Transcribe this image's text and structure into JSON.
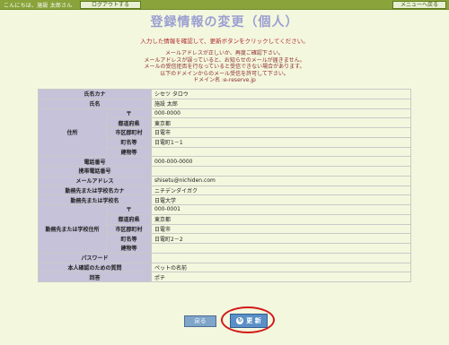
{
  "header": {
    "greeting": "こんにちは、施設 太郎さん",
    "logout_label": "ログアウトする",
    "menu_label": "メニューへ戻る"
  },
  "page": {
    "title": "登録情報の変更（個人）",
    "instruction": "入力した情報を確認して、更新ボタンをクリックしてください。",
    "notes": [
      "メールアドレスが正しいか、再度ご確認下さい。",
      "メールアドレスが誤っていると、お知らせのメールが届きません。",
      "メールの受信拒否を行なっていると受信できない場合があります。",
      "以下のドメインからのメール受信を許可して下さい。",
      "ドメイン名 :e-reserve.jp"
    ]
  },
  "form": {
    "kana_name": {
      "label": "氏名カナ",
      "value": "シセツ タロウ"
    },
    "name": {
      "label": "氏名",
      "value": "施設 太郎"
    },
    "address": {
      "label": "住所",
      "postal": {
        "label": "〒",
        "value": "000-0000"
      },
      "prefecture": {
        "label": "都道府県",
        "value": "東京都"
      },
      "city": {
        "label": "市区郡町村",
        "value": "日電市"
      },
      "town": {
        "label": "町名等",
        "value": "日電町1－1"
      },
      "building": {
        "label": "建物等",
        "value": ""
      }
    },
    "phone": {
      "label": "電話番号",
      "value": "000-000-0000"
    },
    "mobile": {
      "label": "携帯電話番号",
      "value": ""
    },
    "email": {
      "label": "メールアドレス",
      "value": "shisetu@nichiden.com"
    },
    "work_kana": {
      "label": "勤務先または学校名カナ",
      "value": "ニチデンダイガク"
    },
    "work_name": {
      "label": "勤務先または学校名",
      "value": "日電大学"
    },
    "work_address": {
      "label": "勤務先または学校住所",
      "postal": {
        "label": "〒",
        "value": "000-0001"
      },
      "prefecture": {
        "label": "都道府県",
        "value": "東京都"
      },
      "city": {
        "label": "市区郡町村",
        "value": "日電市"
      },
      "town": {
        "label": "町名等",
        "value": "日電町2－2"
      },
      "building": {
        "label": "建物等",
        "value": ""
      }
    },
    "password": {
      "label": "パスワード",
      "value": ""
    },
    "question": {
      "label": "本人確認のための質問",
      "value": "ペットの名前"
    },
    "answer": {
      "label": "回答",
      "value": "ポチ"
    }
  },
  "buttons": {
    "back_label": "戻る",
    "update_label": "更 新"
  }
}
